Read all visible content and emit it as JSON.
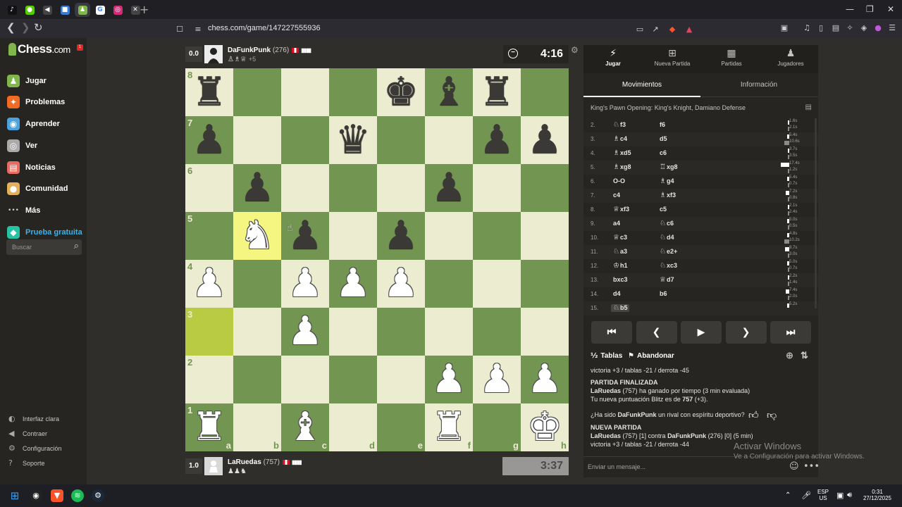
{
  "browser": {
    "url": "chess.com/game/147227555936",
    "tabs": [
      {
        "icon": "tiktok-icon",
        "glyph": "♪",
        "color": "#111111"
      },
      {
        "icon": "duolingo-icon",
        "glyph": "●",
        "color": "#58cc02"
      },
      {
        "icon": "audio-tab-icon",
        "glyph": "◀",
        "color": "#444444"
      },
      {
        "icon": "app-tab-icon",
        "glyph": "■",
        "color": "#3a7bd5"
      },
      {
        "icon": "chess-tab-icon",
        "glyph": "♟",
        "color": "#81b64c"
      },
      {
        "icon": "google-icon",
        "glyph": "G",
        "color": "#ffffff"
      },
      {
        "icon": "instagram-icon",
        "glyph": "◎",
        "color": "#d62976"
      },
      {
        "icon": "muted-tab-icon",
        "glyph": "✕",
        "color": "#444444"
      }
    ],
    "new_tab": "+"
  },
  "sidebar": {
    "logo_main": "Chess",
    "logo_suffix": ".com",
    "notif_count": "1",
    "items": [
      {
        "label": "Jugar",
        "icon": "play-icon",
        "glyph": "♟",
        "color": "#81b64c"
      },
      {
        "label": "Problemas",
        "icon": "puzzle-icon",
        "glyph": "✦",
        "color": "#f26b24"
      },
      {
        "label": "Aprender",
        "icon": "learn-icon",
        "glyph": "◉",
        "color": "#4aa3df"
      },
      {
        "label": "Ver",
        "icon": "watch-icon",
        "glyph": "◎",
        "color": "#aaaaaa"
      },
      {
        "label": "Noticias",
        "icon": "news-icon",
        "glyph": "▤",
        "color": "#e86b5f"
      },
      {
        "label": "Comunidad",
        "icon": "community-icon",
        "glyph": "●",
        "color": "#e2b15a"
      },
      {
        "label": "Más",
        "icon": "more-icon",
        "glyph": "•••",
        "color": "#262522"
      },
      {
        "label": "Prueba gratuita",
        "icon": "diamond-icon",
        "glyph": "◆",
        "color": "#26c2a3"
      }
    ],
    "search_placeholder": "Buscar",
    "bottom": [
      {
        "label": "Interfaz clara",
        "icon": "contrast-icon",
        "glyph": "◐"
      },
      {
        "label": "Contraer",
        "icon": "collapse-icon",
        "glyph": "◀"
      },
      {
        "label": "Configuración",
        "icon": "settings-icon",
        "glyph": "⚙"
      },
      {
        "label": "Soporte",
        "icon": "support-icon",
        "glyph": "?"
      }
    ]
  },
  "top_player": {
    "score": "0.0",
    "name": "DaFunkPunk",
    "rating": "(276)",
    "captured": "♙♗♕",
    "advantage": "+5",
    "clock": "4:16"
  },
  "bottom_player": {
    "score": "1.0",
    "name": "LaRuedas",
    "rating": "(757)",
    "captured": "♟♟♞",
    "clock": "3:37"
  },
  "board": {
    "files": [
      "a",
      "b",
      "c",
      "d",
      "e",
      "f",
      "g",
      "h"
    ],
    "ranks": [
      "8",
      "7",
      "6",
      "5",
      "4",
      "3",
      "2",
      "1"
    ],
    "highlights": [
      "b5",
      "a3"
    ],
    "pieces": {
      "a8": "bR",
      "e8": "bK",
      "f8": "bB",
      "g8": "bR",
      "a7": "bP",
      "d7": "bQ",
      "g7": "bP",
      "h7": "bP",
      "b6": "bP",
      "f6": "bP",
      "b5": "wN",
      "c5": "bP",
      "e5": "bP",
      "a4": "wP",
      "c4": "wP",
      "d4": "wP",
      "e4": "wP",
      "c3": "wP",
      "f2": "wP",
      "g2": "wP",
      "h2": "wP",
      "a1": "wR",
      "c1": "wB",
      "f1": "wR",
      "h1": "wK"
    }
  },
  "panel": {
    "tabs": [
      {
        "label": "Jugar",
        "icon": "bolt-icon",
        "glyph": "⚡"
      },
      {
        "label": "Nueva Partida",
        "icon": "plus-square-icon",
        "glyph": "⊞"
      },
      {
        "label": "Partidas",
        "icon": "board-icon",
        "glyph": "▦"
      },
      {
        "label": "Jugadores",
        "icon": "players-icon",
        "glyph": "♟"
      }
    ],
    "subtabs": [
      "Movimientos",
      "Información"
    ],
    "opening": "King's Pawn Opening: King's Knight, Damiano Defense",
    "moves": [
      {
        "n": "2.",
        "wp": "♘",
        "w": "f3",
        "bp": "",
        "b": "f6",
        "tw": "1.6s",
        "tb": "2.1s",
        "fw": 0.05,
        "fb": 0.06
      },
      {
        "n": "3.",
        "wp": "♗",
        "w": "c4",
        "bp": "",
        "b": "d5",
        "tw": "5.4s",
        "tb": "10.6s",
        "fw": 0.17,
        "fb": 0.35
      },
      {
        "n": "4.",
        "wp": "♗",
        "w": "xd5",
        "bp": "",
        "b": "c6",
        "tw": "3.7s",
        "tb": "3.5s",
        "fw": 0.12,
        "fb": 0.11
      },
      {
        "n": "5.",
        "wp": "♗",
        "w": "xg8",
        "bp": "♖",
        "b": "xg8",
        "tw": "17.4s",
        "tb": "1.2s",
        "fw": 0.6,
        "fb": 0.04
      },
      {
        "n": "6.",
        "wp": "",
        "w": "O-O",
        "bp": "♗",
        "b": "g4",
        "tw": "5.4s",
        "tb": "0.7s",
        "fw": 0.17,
        "fb": 0.02
      },
      {
        "n": "7.",
        "wp": "",
        "w": "c4",
        "bp": "♗",
        "b": "xf3",
        "tw": "7.2s",
        "tb": "0.8s",
        "fw": 0.23,
        "fb": 0.03
      },
      {
        "n": "8.",
        "wp": "♕",
        "w": "xf3",
        "bp": "",
        "b": "c5",
        "tw": "2.1s",
        "tb": "2.4s",
        "fw": 0.07,
        "fb": 0.08
      },
      {
        "n": "9.",
        "wp": "",
        "w": "a4",
        "bp": "♘",
        "b": "c6",
        "tw": "5.0s",
        "tb": "0.5s",
        "fw": 0.16,
        "fb": 0.02
      },
      {
        "n": "10.",
        "wp": "♕",
        "w": "c3",
        "bp": "♘",
        "b": "d4",
        "tw": "4.8s",
        "tb": "10.2s",
        "fw": 0.15,
        "fb": 0.33
      },
      {
        "n": "11.",
        "wp": "♘",
        "w": "a3",
        "bp": "♘",
        "b": "e2+",
        "tw": "9.7s",
        "tb": "3.0s",
        "fw": 0.31,
        "fb": 0.1
      },
      {
        "n": "12.",
        "wp": "♔",
        "w": "h1",
        "bp": "♘",
        "b": "xc3",
        "tw": "5.0s",
        "tb": "0.7s",
        "fw": 0.16,
        "fb": 0.02
      },
      {
        "n": "13.",
        "wp": "",
        "w": "bxc3",
        "bp": "♕",
        "b": "d7",
        "tw": "2.2s",
        "tb": "1.4s",
        "fw": 0.07,
        "fb": 0.05
      },
      {
        "n": "14.",
        "wp": "",
        "w": "d4",
        "bp": "",
        "b": "b6",
        "tw": "7.4s",
        "tb": "2.0s",
        "fw": 0.24,
        "fb": 0.06
      },
      {
        "n": "15.",
        "wp": "♘",
        "w": "b5",
        "bp": "",
        "b": "",
        "tw": "5.2s",
        "tb": "",
        "fw": 0.17,
        "fb": 0
      }
    ],
    "nav_buttons": [
      {
        "name": "first-move-button",
        "glyph": "⏮"
      },
      {
        "name": "prev-move-button",
        "glyph": "❮"
      },
      {
        "name": "play-button",
        "glyph": "▶"
      },
      {
        "name": "next-move-button",
        "glyph": "❯"
      },
      {
        "name": "last-move-button",
        "glyph": "⏭"
      }
    ],
    "draw_label": "Tablas",
    "draw_glyph": "½",
    "resign_label": "Abandonar",
    "resign_glyph": "⚑",
    "chat": {
      "line1": "victoria +3 / tablas -21 / derrota -45",
      "finished": "PARTIDA FINALIZADA",
      "winner_name": "LaRuedas",
      "winner_rest": " (757) ha ganado por tiempo (3 min evaluada)",
      "new_score_pre": "Tu nueva puntuación Blitz es de ",
      "new_score_val": "757",
      "new_score_post": " (+3).",
      "sport_pre": "¿Ha sido ",
      "sport_name": "DaFunkPunk",
      "sport_post": " un rival con espíritu deportivo?",
      "new_game": "NUEVA PARTIDA",
      "ng_name1": "LaRuedas",
      "ng_mid": " (757) [1] contra ",
      "ng_name2": "DaFunkPunk",
      "ng_end": " (276) [0] (5 min)",
      "line_last": "victoria +3 / tablas -21 / derrota -44",
      "placeholder": "Enviar un mensaje..."
    }
  },
  "watermark": {
    "title": "Activar Windows",
    "subtitle": "Ve a Configuración para activar Windows."
  },
  "taskbar": {
    "lang": "ESP",
    "region": "US",
    "time": "0:31",
    "date": "27/12/2025"
  }
}
